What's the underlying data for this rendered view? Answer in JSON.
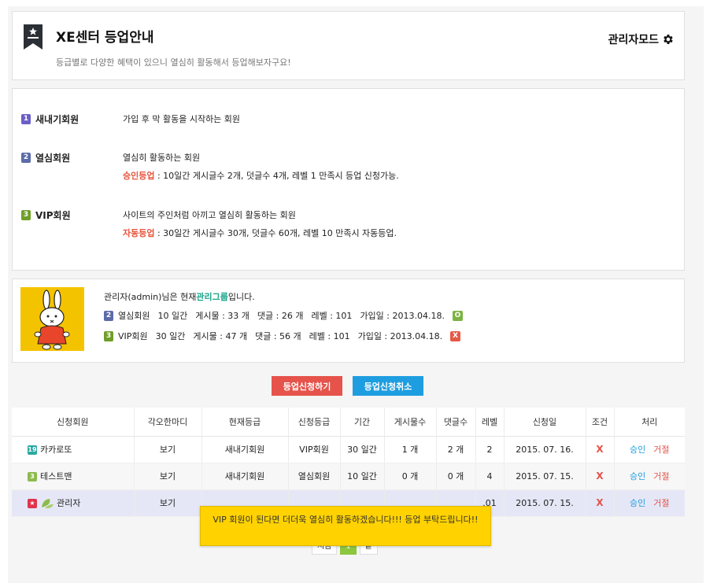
{
  "header": {
    "title": "XE센터 등업안내",
    "subtitle": "등급별로 다양한 혜택이 있으니 열심히 활동해서 등업해보자구요!",
    "admin_mode": "관리자모드"
  },
  "levels": [
    {
      "num": "1",
      "name": "새내기회원",
      "desc": "가입 후 막 활동을 시작하는 회원"
    },
    {
      "num": "2",
      "name": "열심회원",
      "desc": "열심히 활동하는 회원",
      "rule_label": "승인등업",
      "rule": " : 10일간 게시글수 2개, 덧글수 4개, 레벨 1 만족시 등업 신청가능."
    },
    {
      "num": "3",
      "name": "VIP회원",
      "desc": "사이트의 주인처럼 아끼고 열심히 활동하는 회원",
      "rule_label": "자동등업",
      "rule": " : 30일간 게시글수 30개, 덧글수 60개, 레벨 10 만족시 자동등업."
    }
  ],
  "user": {
    "intro_prefix": "관리자(admin)님은 현재 ",
    "group": "관리그룹",
    "intro_suffix": " 입니다.",
    "rows": [
      {
        "num": "2",
        "grade": "열심회원",
        "period": "10 일간",
        "posts": "게시물 : 33 개",
        "comments": "댓글 : 26 개",
        "level": "레벨 : 101",
        "joined": "가입일 : 2013.04.18.",
        "status": "O"
      },
      {
        "num": "3",
        "grade": "VIP회원",
        "period": "30 일간",
        "posts": "게시물 : 47 개",
        "comments": "댓글 : 56 개",
        "level": "레벨 : 101",
        "joined": "가입일 : 2013.04.18.",
        "status": "X"
      }
    ]
  },
  "buttons": {
    "apply": "등업신청하기",
    "cancel": "등업신청취소"
  },
  "table": {
    "headers": [
      "신청회원",
      "각오한마디",
      "현재등급",
      "신청등급",
      "기간",
      "게시물수",
      "댓글수",
      "레벨",
      "신청일",
      "조건",
      "처리"
    ],
    "rows": [
      {
        "badge": "19",
        "member": "카카로또",
        "comment": "보기",
        "current": "새내기회원",
        "requested": "VIP회원",
        "period": "30 일간",
        "posts": "1 개",
        "comments": "2 개",
        "level": "2",
        "date": "2015. 07. 16.",
        "cond": "X",
        "approve": "승인",
        "reject": "거절"
      },
      {
        "badge": "3",
        "member": "테스트맨",
        "comment": "보기",
        "current": "새내기회원",
        "requested": "열심회원",
        "period": "10 일간",
        "posts": "0 개",
        "comments": "0 개",
        "level": "4",
        "date": "2015. 07. 15.",
        "cond": "X",
        "approve": "승인",
        "reject": "거절"
      },
      {
        "badge": "★",
        "member": "관리자",
        "comment": "보기",
        "current": "",
        "requested": "",
        "period": "",
        "posts": "",
        "comments": "",
        "level": ".01",
        "date": "2015. 07. 15.",
        "cond": "X",
        "approve": "승인",
        "reject": "거절"
      }
    ]
  },
  "pager": {
    "first": "처음",
    "current": "1",
    "last": "끝"
  },
  "tooltip": "VIP 회원이 된다면 더더욱 열심히 활동하겠습니다!!! 등업 부탁드립니다!!"
}
